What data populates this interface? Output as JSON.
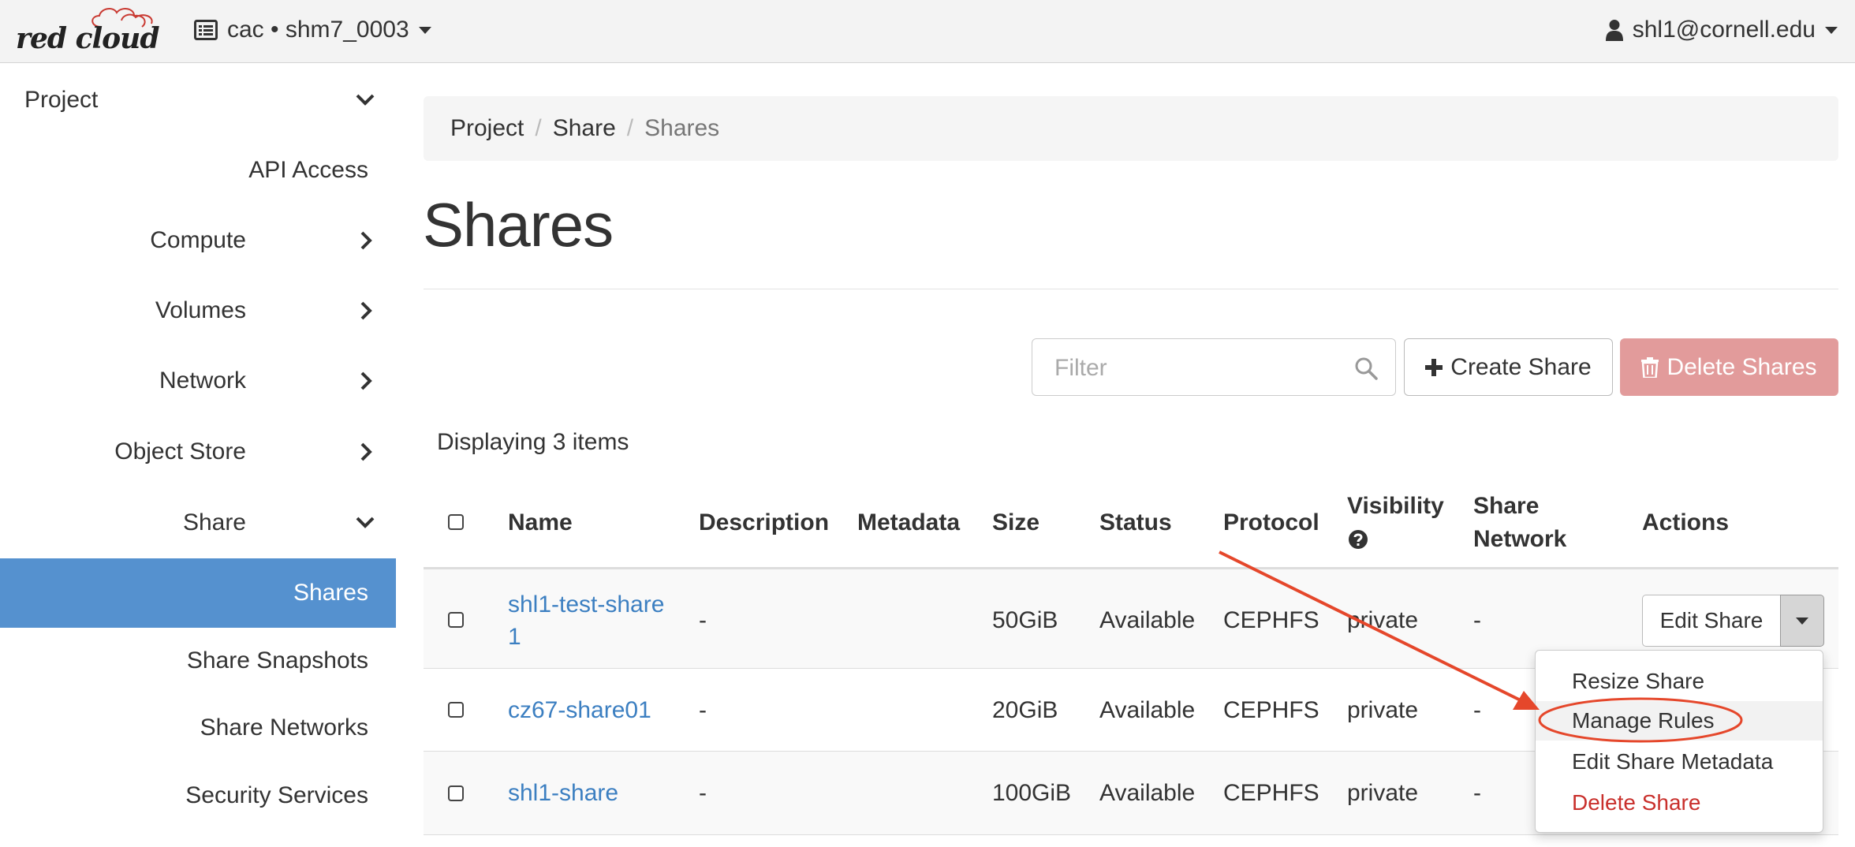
{
  "brand": {
    "name": "red cloud"
  },
  "topbar": {
    "project_context": "cac • shm7_0003",
    "user": "shl1@cornell.edu"
  },
  "sidebar": {
    "project": "Project",
    "api_access": "API Access",
    "compute": "Compute",
    "volumes": "Volumes",
    "network": "Network",
    "object_store": "Object Store",
    "share": "Share",
    "shares": "Shares",
    "share_snapshots": "Share Snapshots",
    "share_networks": "Share Networks",
    "security_services": "Security Services"
  },
  "breadcrumb": {
    "items": [
      "Project",
      "Share",
      "Shares"
    ],
    "separator": "/"
  },
  "page": {
    "title": "Shares"
  },
  "toolbar": {
    "filter_placeholder": "Filter",
    "create_label": "Create Share",
    "delete_label": "Delete Shares"
  },
  "table": {
    "count_text": "Displaying 3 items",
    "headers": {
      "name": "Name",
      "description": "Description",
      "metadata": "Metadata",
      "size": "Size",
      "status": "Status",
      "protocol": "Protocol",
      "visibility": "Visibility",
      "share_network_1": "Share",
      "share_network_2": "Network",
      "actions": "Actions"
    },
    "rows": [
      {
        "name_1": "shl1-test-share",
        "name_2": "1",
        "description": "-",
        "size": "50GiB",
        "status": "Available",
        "protocol": "CEPHFS",
        "visibility": "private",
        "share_network": "-"
      },
      {
        "name_1": "cz67-share01",
        "description": "-",
        "size": "20GiB",
        "status": "Available",
        "protocol": "CEPHFS",
        "visibility": "private",
        "share_network": "-"
      },
      {
        "name_1": "shl1-share",
        "description": "-",
        "size": "100GiB",
        "status": "Available",
        "protocol": "CEPHFS",
        "visibility": "private",
        "share_network": "-"
      }
    ],
    "row_action": "Edit Share"
  },
  "dropdown": {
    "items": [
      "Resize Share",
      "Manage Rules",
      "Edit Share Metadata",
      "Delete Share"
    ]
  },
  "colors": {
    "accent": "#5591cf",
    "link": "#3c7fc1",
    "danger": "#c9302c",
    "annotation": "#e5472b"
  },
  "icons": {
    "project_switch": "list-icon",
    "user": "user-icon",
    "search": "search-icon",
    "create": "plus-icon",
    "delete": "trash-icon",
    "visibility_help": "question-circle-icon"
  }
}
